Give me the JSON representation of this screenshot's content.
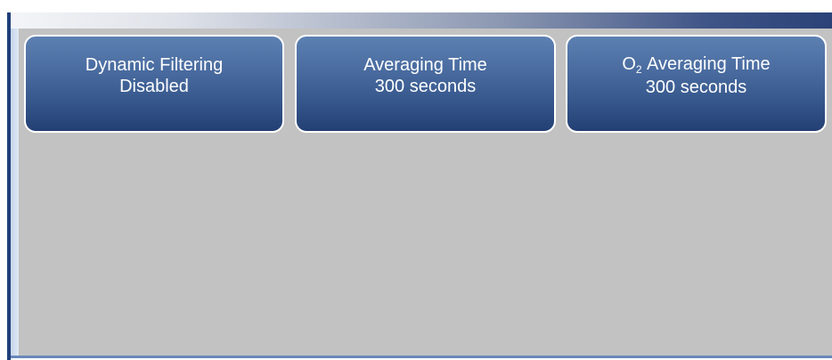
{
  "colors": {
    "title_bar_dark": "#2a4277",
    "panel_background": "#c2c2c2",
    "button_top": "#5d80b2",
    "button_bottom": "#233f73",
    "button_border": "#ffffff",
    "left_bar": "#1f3f79"
  },
  "buttons": [
    {
      "line1": "Dynamic Filtering",
      "line2": "Disabled"
    },
    {
      "line1": "Averaging Time",
      "line2": "300 seconds"
    },
    {
      "line1_prefix": "O",
      "line1_subscript": "2",
      "line1_suffix": " Averaging Time",
      "line2": "300 seconds"
    }
  ]
}
